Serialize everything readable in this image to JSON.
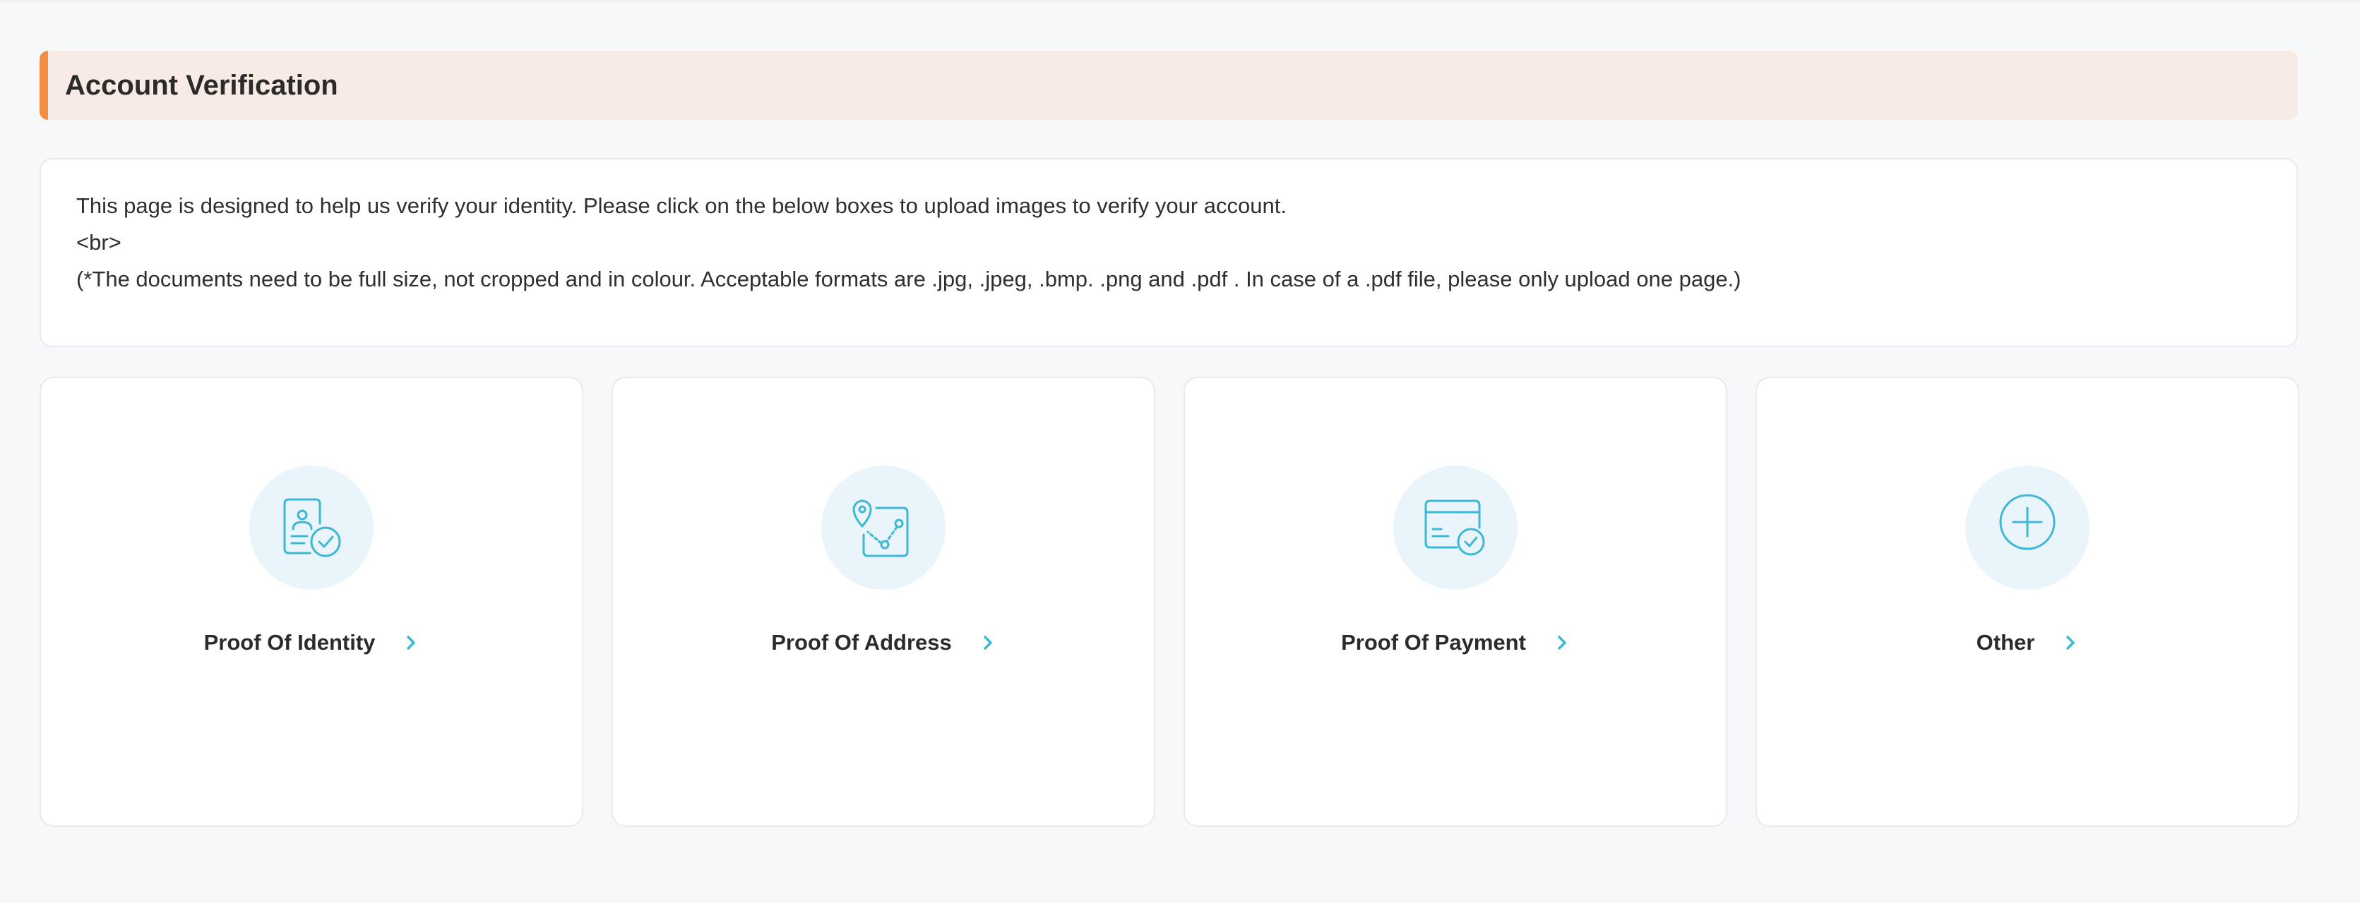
{
  "header": {
    "title": "Account Verification",
    "accent_color": "#f28d44"
  },
  "info": {
    "line1": "This page is designed to help us verify your identity. Please click on the below boxes to upload images to verify your account.",
    "line2": "<br>",
    "line3": "(*The documents need to be full size, not cropped and in colour. Acceptable formats are .jpg, .jpeg, .bmp. .png and .pdf . In case of a .pdf file, please only upload one page.)"
  },
  "cards": [
    {
      "label": "Proof Of Identity",
      "icon": "id-card-check-icon"
    },
    {
      "label": "Proof Of Address",
      "icon": "map-route-icon"
    },
    {
      "label": "Proof Of Payment",
      "icon": "credit-card-check-icon"
    },
    {
      "label": "Other",
      "icon": "plus-circle-icon"
    }
  ],
  "colors": {
    "icon": "#3db8d4",
    "icon_bg": "#eaf4fb",
    "page_bg": "#f6f8fa"
  }
}
